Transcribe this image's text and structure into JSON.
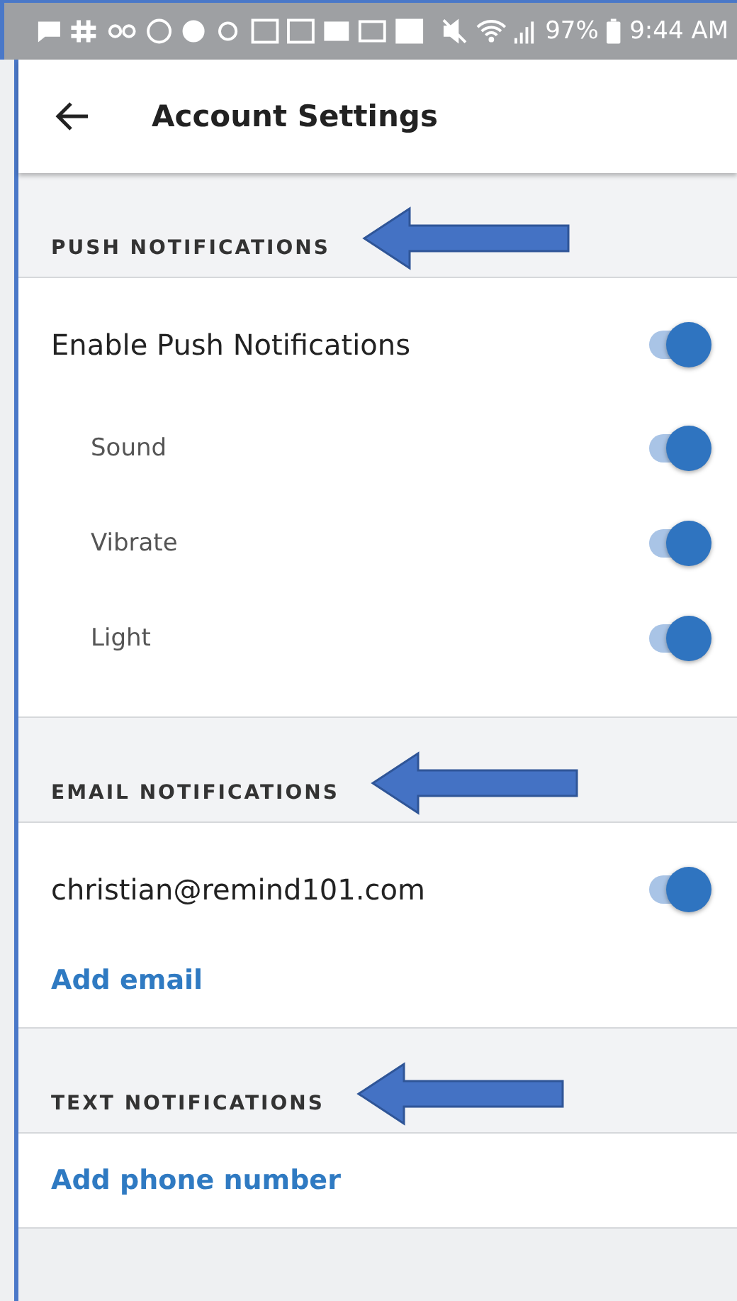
{
  "status_bar": {
    "battery": "97%",
    "time": "9:44 AM"
  },
  "header": {
    "title": "Account Settings"
  },
  "sections": [
    {
      "title": "PUSH NOTIFICATIONS",
      "items": [
        {
          "label": "Enable Push Notifications",
          "on": true,
          "children": [
            {
              "label": "Sound",
              "on": true
            },
            {
              "label": "Vibrate",
              "on": true
            },
            {
              "label": "Light",
              "on": true
            }
          ]
        }
      ]
    },
    {
      "title": "EMAIL NOTIFICATIONS",
      "items": [
        {
          "label": "christian@remind101.com",
          "on": true
        }
      ],
      "link": "Add email"
    },
    {
      "title": "TEXT NOTIFICATIONS",
      "link": "Add phone number"
    }
  ]
}
